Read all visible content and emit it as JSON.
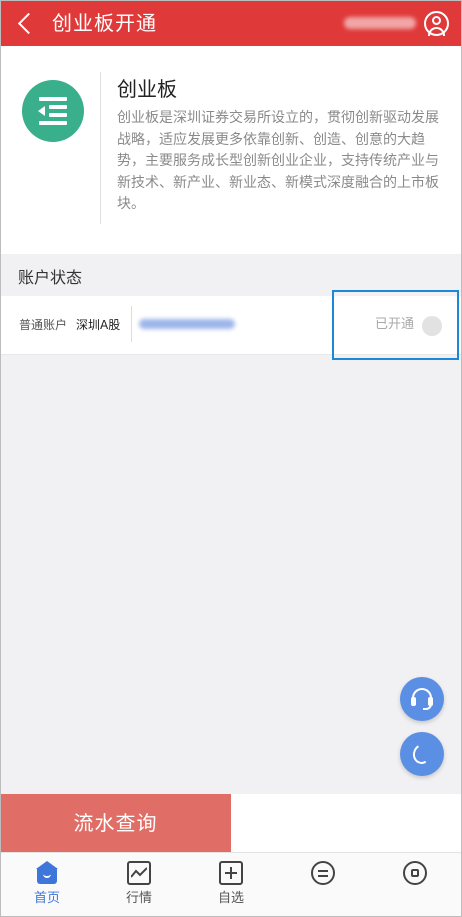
{
  "header": {
    "title": "创业板开通",
    "back_icon": "chevron-left-icon",
    "user_icon": "user-circle-icon"
  },
  "intro": {
    "logo_icon": "indent-list-icon",
    "title": "创业板",
    "description": "创业板是深圳证券交易所设立的，贯彻创新驱动发展战略，适应发展更多依靠创新、创造、创意的大趋势，主要服务成长型创新创业企业，支持传统产业与新技术、新产业、新业态、新模式深度融合的上市板块。"
  },
  "account_section": {
    "title": "账户状态",
    "rows": [
      {
        "type": "普通账户",
        "market": "深圳A股",
        "status": "已开通"
      }
    ]
  },
  "floating": {
    "service_icon": "headset-icon",
    "phone_icon": "phone-icon"
  },
  "flow_button": {
    "label": "流水查询"
  },
  "tabbar": {
    "tabs": [
      {
        "label": "首页",
        "icon": "home-icon",
        "active": true
      },
      {
        "label": "行情",
        "icon": "chart-icon",
        "active": false
      },
      {
        "label": "自选",
        "icon": "add-watchlist-icon",
        "active": false
      },
      {
        "label": "",
        "icon": "exchange-icon",
        "active": false
      },
      {
        "label": "",
        "icon": "wealth-icon",
        "active": false
      }
    ]
  },
  "colors": {
    "header_bg": "#e0393a",
    "accent_blue": "#3e77d9",
    "logo_green": "#3aaf8c",
    "flow_button_bg": "#e06e66",
    "highlight_border": "#1e88d8"
  }
}
